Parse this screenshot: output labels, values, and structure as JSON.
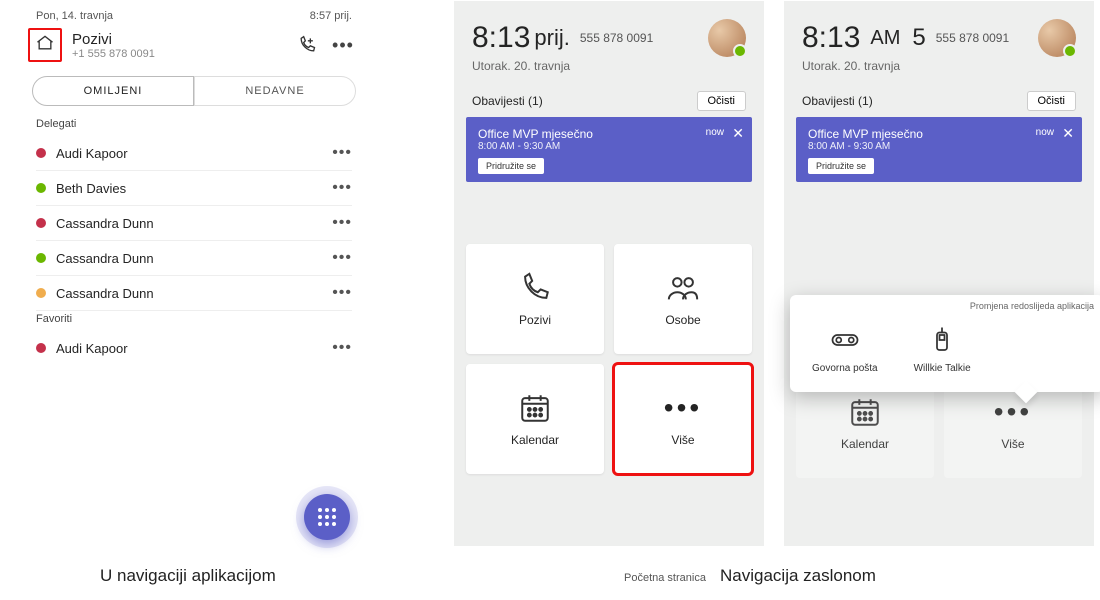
{
  "phone1": {
    "status_date": "Pon, 14. travnja",
    "status_time": "8:57 prij.",
    "title": "Pozivi",
    "subtitle": "+1 555 878 0091",
    "seg_fav": "OMILJENI",
    "seg_recent": "NEDAVNE",
    "section_delegates": "Delegati",
    "section_favorites": "Favoriti",
    "contacts": [
      {
        "status": "red",
        "name": "Audi Kapoor"
      },
      {
        "status": "green",
        "name": "Beth Davies"
      },
      {
        "status": "red",
        "name": "Cassandra Dunn"
      },
      {
        "status": "green",
        "name": "Cassandra Dunn"
      },
      {
        "status": "orange",
        "name": "Cassandra Dunn"
      }
    ],
    "favorites": [
      {
        "status": "red",
        "name": "Audi Kapoor"
      }
    ]
  },
  "phone2": {
    "clock": "8:13",
    "ampm": "prij.",
    "number": "555 878 0091",
    "date": "Utorak. 20. travnja",
    "notif_label": "Obavijesti (1)",
    "clear": "Očisti",
    "event_title": "Office MVP mjesečno",
    "event_time": "8:00 AM - 9:30 AM",
    "event_now": "now",
    "join": "Pridružite se",
    "tile_calls": "Pozivi",
    "tile_people": "Osobe",
    "tile_calendar": "Kalendar",
    "tile_more": "Više"
  },
  "phone3": {
    "clock": "8:13",
    "ampm": "AM",
    "extra": "5",
    "number": "555 878 0091",
    "date": "Utorak. 20. travnja",
    "notif_label": "Obavijesti (1)",
    "clear": "Očisti",
    "event_title": "Office MVP mjesečno",
    "event_time": "8:00 AM - 9:30 AM",
    "event_now": "now",
    "join": "Pridružite se",
    "pop_link": "Promjena redoslijeda aplikacija",
    "pop_voicemail": "Govorna pošta",
    "pop_walkie": "Willkie Talkie",
    "tile_calendar": "Kalendar",
    "tile_more": "Više"
  },
  "captions": {
    "c1": "U navigaciji aplikacijom",
    "c2": "Početna stranica",
    "c3": "Navigacija zaslonom"
  }
}
